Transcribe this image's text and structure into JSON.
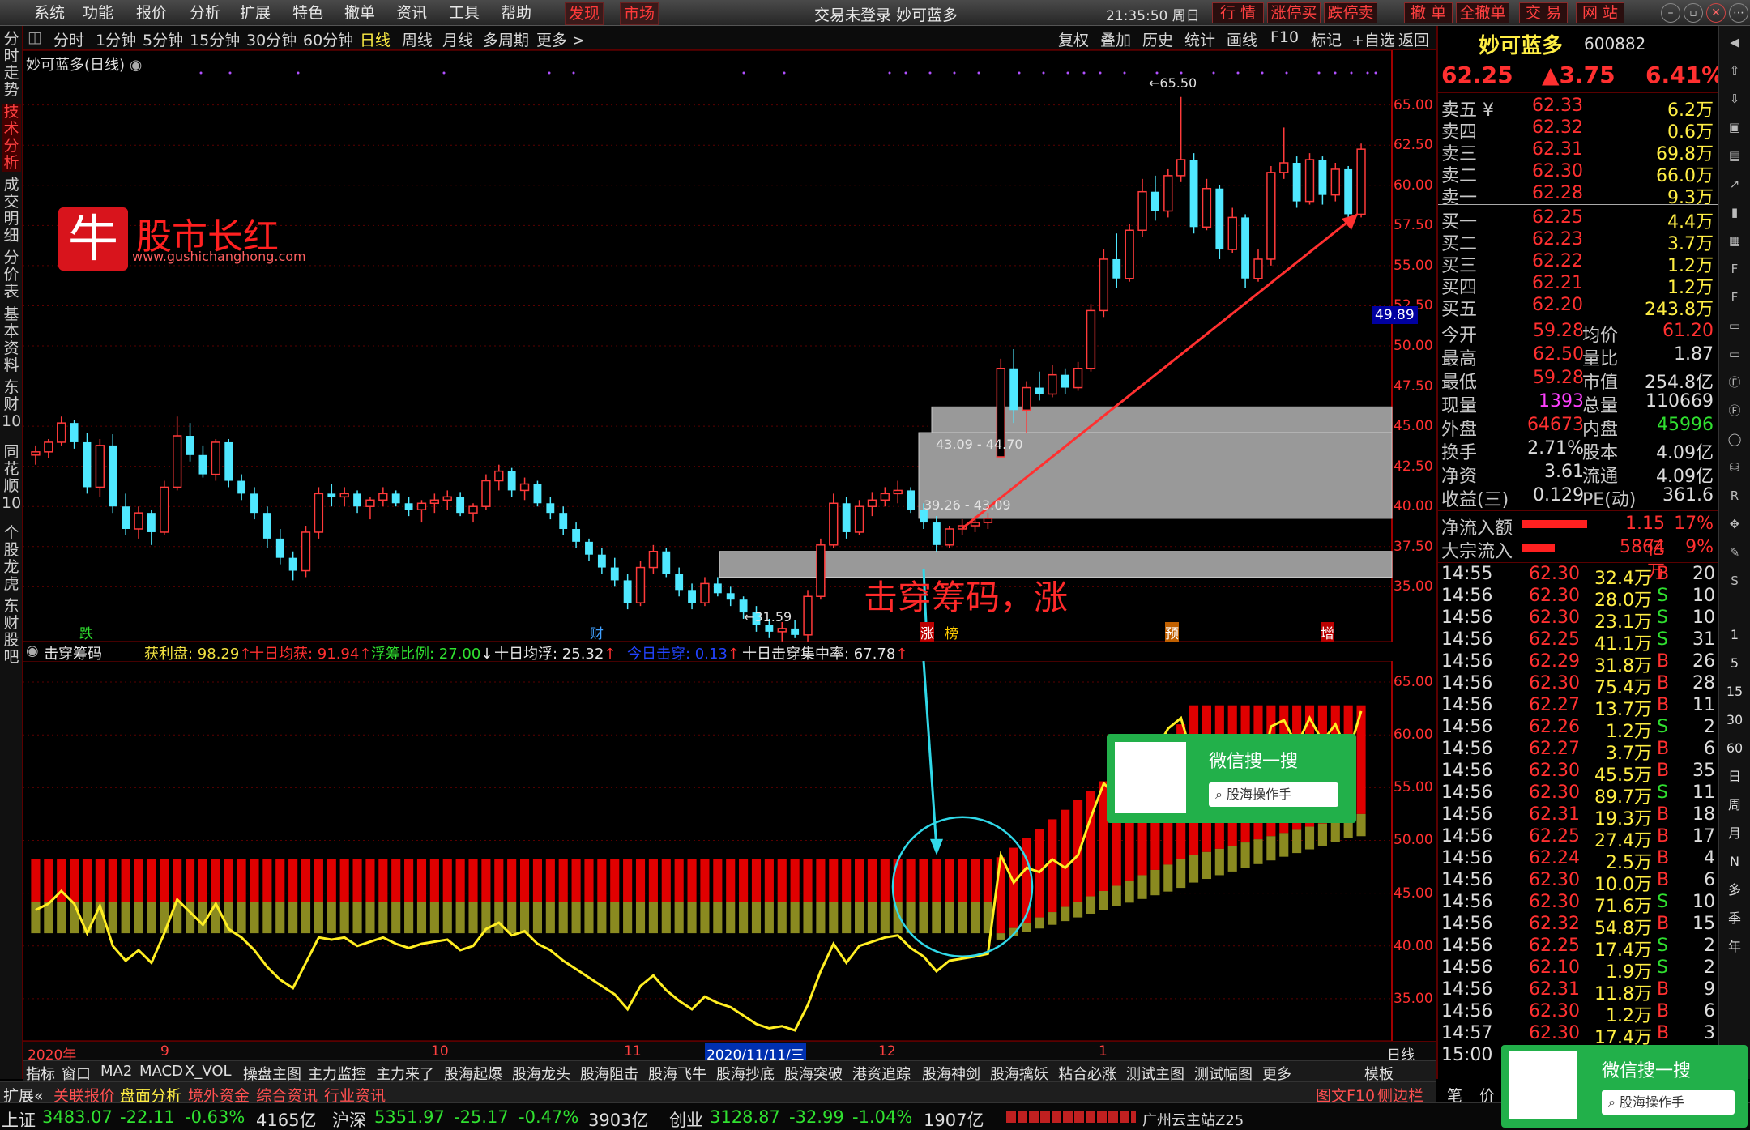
{
  "menu": [
    "系统",
    "功能",
    "报价",
    "分析",
    "扩展",
    "特色",
    "撤单",
    "资讯",
    "工具",
    "帮助",
    "发现",
    "市场"
  ],
  "window_title": "交易未登录  妙可蓝多",
  "clock": "21:35:50 周日",
  "trade_buttons": [
    "行 情",
    "涨停买",
    "跌停卖",
    "撤 单",
    "全撤单",
    "交 易",
    "网 站"
  ],
  "left_nav": [
    "分时走势",
    "技术分析",
    "成交明细",
    "分价表",
    "基本资料",
    "东财10",
    "同花顺10",
    "个股龙虎",
    "东财股吧"
  ],
  "periods": [
    "分时",
    "1分钟",
    "5分钟",
    "15分钟",
    "30分钟",
    "60分钟",
    "日线",
    "周线",
    "月线",
    "多周期",
    "更多 >"
  ],
  "right_tools": [
    "复权",
    "叠加",
    "历史",
    "统计",
    "画线",
    "F10",
    "标记",
    "+自选",
    "返回"
  ],
  "chart_title": "妙可蓝多(日线)",
  "price_axis": [
    "65.00",
    "62.50",
    "60.00",
    "57.50",
    "55.00",
    "52.50",
    "50.00",
    "47.50",
    "45.00",
    "42.50",
    "40.00",
    "37.50",
    "35.00"
  ],
  "current_price_tag": "49.89",
  "annotations": {
    "high": "65.50",
    "low": "31.59",
    "zone1": "43.09 - 44.70",
    "zone2": "39.26 - 43.09"
  },
  "event_markers": [
    "跌",
    "财",
    "涨",
    "榜",
    "预",
    "增"
  ],
  "watermark": {
    "glyph": "牛",
    "name": "股市长红",
    "url": "www.gushichanghong.com"
  },
  "red_caption": "击穿筹码，涨",
  "indicator": {
    "name": "击穿筹码",
    "items": [
      {
        "label": "获利盘: 98.29",
        "arrow": "↑",
        "color": "#f0e040"
      },
      {
        "label": "十日均获: 91.94",
        "arrow": "↑",
        "color": "#ff3030"
      },
      {
        "label": "浮筹比例: 27.00",
        "arrow": "↓",
        "color": "#30e030"
      },
      {
        "label": "十日均浮: 25.32",
        "arrow": "↑",
        "color": "#e6e6e6"
      },
      {
        "label": "今日击穿: 0.13",
        "arrow": "↑",
        "color": "#2244ff"
      },
      {
        "label": "十日击穿集中率: 67.78",
        "arrow": "↑",
        "color": "#e6e6e6"
      }
    ],
    "axis": [
      "65.00",
      "60.00",
      "55.00",
      "50.00",
      "45.00",
      "40.00",
      "35.00"
    ]
  },
  "wechat": {
    "text": "微信搜一搜",
    "search": "股海操作手"
  },
  "date_axis": [
    "2020年",
    "9",
    "10",
    "11",
    "2020/11/11/三",
    "12",
    "1",
    "日线"
  ],
  "bottom_tabs": [
    "指标",
    "窗口",
    "MA2",
    "MACD",
    "X_VOL",
    "操盘主图",
    "主力监控",
    "主力来了",
    "股海起爆",
    "股海龙头",
    "股海阻击",
    "股海飞牛",
    "股海抄底",
    "股海突破",
    "港资追踪",
    "股海神剑",
    "股海擒妖",
    "粘合必涨",
    "测试主图",
    "测试幅图",
    "更多",
    "模板"
  ],
  "bottom_bar": [
    "扩展«",
    "关联报价",
    "盘面分析",
    "境外资金",
    "综合资讯",
    "行业资讯"
  ],
  "bottom_right": [
    "图文F10",
    "侧边栏 «",
    "笔",
    "价"
  ],
  "indices": [
    {
      "name": "上证",
      "val": "3483.07",
      "chg": "-22.11",
      "pct": "-0.63%",
      "amt": "4165亿"
    },
    {
      "name": "沪深",
      "val": "5351.97",
      "chg": "-25.17",
      "pct": "-0.47%",
      "amt": "3903亿"
    },
    {
      "name": "创业",
      "val": "3128.87",
      "chg": "-32.99",
      "pct": "-1.04%",
      "amt": "1907亿"
    }
  ],
  "server": "广州云主站Z25",
  "quote": {
    "name": "妙可蓝多",
    "code": "600882",
    "price": "62.25",
    "change": "▲3.75",
    "pct": "6.41%",
    "sells": [
      [
        "卖五 ¥",
        "62.33",
        "6.2万"
      ],
      [
        "卖四",
        "62.32",
        "0.6万"
      ],
      [
        "卖三",
        "62.31",
        "69.8万"
      ],
      [
        "卖二",
        "62.30",
        "66.0万"
      ],
      [
        "卖一",
        "62.28",
        "9.3万"
      ]
    ],
    "buys": [
      [
        "买一",
        "62.25",
        "4.4万"
      ],
      [
        "买二",
        "62.23",
        "3.7万"
      ],
      [
        "买三",
        "62.22",
        "1.2万"
      ],
      [
        "买四",
        "62.21",
        "1.2万"
      ],
      [
        "买五",
        "62.20",
        "243.8万"
      ]
    ],
    "stats": [
      [
        "今开",
        "59.28",
        "均价",
        "61.20"
      ],
      [
        "最高",
        "62.50",
        "量比",
        "1.87"
      ],
      [
        "最低",
        "59.28",
        "市值",
        "254.8亿"
      ],
      [
        "现量",
        "1393",
        "总量",
        "110669"
      ],
      [
        "外盘",
        "64673",
        "内盘",
        "45996"
      ],
      [
        "换手",
        "2.71%",
        "股本",
        "4.09亿"
      ],
      [
        "净资",
        "3.61",
        "流通",
        "4.09亿"
      ],
      [
        "收益(三)",
        "0.129",
        "PE(动)",
        "361.6"
      ]
    ],
    "flows": [
      [
        "净流入额",
        "1.15亿",
        "17%"
      ],
      [
        "大宗流入",
        "5864万",
        "9%"
      ]
    ],
    "ticks": [
      [
        "14:55",
        "62.30",
        "32.4万",
        "B",
        "20"
      ],
      [
        "14:56",
        "62.30",
        "28.0万",
        "S",
        "10"
      ],
      [
        "14:56",
        "62.30",
        "23.1万",
        "S",
        "10"
      ],
      [
        "14:56",
        "62.25",
        "41.1万",
        "S",
        "31"
      ],
      [
        "14:56",
        "62.29",
        "31.8万",
        "B",
        "26"
      ],
      [
        "14:56",
        "62.30",
        "75.4万",
        "B",
        "28"
      ],
      [
        "14:56",
        "62.27",
        "13.7万",
        "B",
        "11"
      ],
      [
        "14:56",
        "62.26",
        "1.2万",
        "S",
        "2"
      ],
      [
        "14:56",
        "62.27",
        "3.7万",
        "B",
        "6"
      ],
      [
        "14:56",
        "62.30",
        "45.5万",
        "B",
        "35"
      ],
      [
        "14:56",
        "62.30",
        "89.7万",
        "S",
        "11"
      ],
      [
        "14:56",
        "62.31",
        "19.3万",
        "B",
        "18"
      ],
      [
        "14:56",
        "62.25",
        "27.4万",
        "B",
        "17"
      ],
      [
        "14:56",
        "62.24",
        "2.5万",
        "B",
        "4"
      ],
      [
        "14:56",
        "62.30",
        "10.0万",
        "B",
        "6"
      ],
      [
        "14:56",
        "62.30",
        "71.6万",
        "S",
        "10"
      ],
      [
        "14:56",
        "62.32",
        "54.8万",
        "B",
        "15"
      ],
      [
        "14:56",
        "62.25",
        "17.4万",
        "S",
        "2"
      ],
      [
        "14:56",
        "62.10",
        "1.9万",
        "S",
        "2"
      ],
      [
        "14:56",
        "62.31",
        "11.8万",
        "B",
        "9"
      ],
      [
        "14:56",
        "62.30",
        "1.2万",
        "B",
        "6"
      ],
      [
        "14:57",
        "62.30",
        "17.4万",
        "B",
        "3"
      ],
      [
        "15:00",
        "",
        "",
        "",
        ""
      ]
    ]
  },
  "side_tool_labels": [
    "1",
    "5",
    "15",
    "30",
    "60",
    "日",
    "周",
    "月",
    "N",
    "多",
    "季",
    "年"
  ],
  "chart_data": {
    "type": "candlestick",
    "title": "妙可蓝多(日线)",
    "ylim": [
      33,
      67
    ],
    "x_labels": [
      "2020年",
      "9",
      "10",
      "11",
      "12",
      "1"
    ],
    "candles": [
      [
        43.2,
        43.8,
        42.6,
        43.4
      ],
      [
        43.4,
        44.2,
        43.0,
        44.0
      ],
      [
        44.0,
        45.6,
        43.8,
        45.2
      ],
      [
        45.2,
        45.4,
        43.6,
        44.0
      ],
      [
        44.0,
        44.6,
        40.8,
        41.2
      ],
      [
        41.2,
        44.2,
        40.6,
        43.8
      ],
      [
        43.8,
        44.5,
        39.6,
        40.0
      ],
      [
        40.0,
        40.8,
        38.2,
        38.6
      ],
      [
        38.6,
        40.0,
        38.0,
        39.6
      ],
      [
        39.6,
        39.8,
        37.6,
        38.4
      ],
      [
        38.4,
        41.6,
        38.2,
        41.2
      ],
      [
        41.2,
        45.6,
        41.0,
        44.4
      ],
      [
        44.4,
        45.2,
        42.8,
        43.2
      ],
      [
        43.2,
        43.8,
        41.8,
        42.0
      ],
      [
        42.0,
        44.2,
        41.6,
        44.0
      ],
      [
        44.0,
        44.2,
        41.2,
        41.6
      ],
      [
        41.6,
        42.0,
        40.4,
        40.8
      ],
      [
        40.8,
        41.2,
        39.2,
        39.6
      ],
      [
        39.6,
        40.0,
        37.4,
        38.0
      ],
      [
        38.0,
        38.6,
        36.4,
        36.8
      ],
      [
        36.8,
        37.2,
        35.4,
        36.0
      ],
      [
        36.0,
        38.8,
        35.6,
        38.4
      ],
      [
        38.4,
        41.2,
        38.0,
        40.8
      ],
      [
        40.8,
        41.4,
        40.0,
        40.6
      ],
      [
        40.6,
        41.2,
        40.0,
        40.8
      ],
      [
        40.8,
        41.0,
        39.6,
        40.0
      ],
      [
        40.0,
        40.6,
        39.2,
        40.4
      ],
      [
        40.4,
        41.2,
        40.0,
        40.8
      ],
      [
        40.8,
        41.0,
        40.0,
        40.2
      ],
      [
        40.2,
        40.6,
        39.4,
        39.8
      ],
      [
        39.8,
        40.4,
        39.0,
        40.2
      ],
      [
        40.2,
        40.8,
        39.6,
        40.4
      ],
      [
        40.4,
        41.0,
        39.8,
        40.6
      ],
      [
        40.6,
        40.9,
        39.4,
        39.6
      ],
      [
        39.6,
        40.2,
        39.0,
        40.0
      ],
      [
        40.0,
        42.0,
        39.8,
        41.6
      ],
      [
        41.6,
        42.6,
        41.0,
        42.2
      ],
      [
        42.2,
        42.4,
        40.6,
        41.0
      ],
      [
        41.0,
        41.8,
        40.4,
        41.4
      ],
      [
        41.4,
        41.6,
        40.0,
        40.2
      ],
      [
        40.2,
        40.6,
        39.2,
        39.6
      ],
      [
        39.6,
        40.0,
        38.2,
        38.6
      ],
      [
        38.6,
        39.0,
        37.4,
        37.8
      ],
      [
        37.8,
        38.0,
        36.6,
        37.0
      ],
      [
        37.0,
        37.4,
        35.8,
        36.2
      ],
      [
        36.2,
        36.8,
        35.0,
        35.4
      ],
      [
        35.4,
        35.8,
        33.6,
        34.0
      ],
      [
        34.0,
        36.6,
        33.8,
        36.2
      ],
      [
        36.2,
        37.6,
        35.8,
        37.2
      ],
      [
        37.2,
        37.4,
        35.6,
        35.8
      ],
      [
        35.8,
        36.2,
        34.4,
        34.8
      ],
      [
        34.8,
        35.2,
        33.6,
        34.0
      ],
      [
        34.0,
        35.6,
        33.8,
        35.2
      ],
      [
        35.2,
        35.6,
        34.4,
        34.6
      ],
      [
        34.6,
        35.0,
        33.8,
        34.2
      ],
      [
        34.2,
        34.4,
        33.0,
        33.4
      ],
      [
        33.4,
        33.8,
        32.2,
        32.6
      ],
      [
        32.6,
        33.0,
        31.8,
        32.2
      ],
      [
        32.2,
        32.8,
        31.6,
        32.4
      ],
      [
        32.4,
        32.9,
        31.8,
        32.0
      ],
      [
        32.0,
        34.8,
        31.59,
        34.4
      ],
      [
        34.4,
        38.0,
        34.2,
        37.6
      ],
      [
        37.6,
        40.8,
        37.4,
        40.2
      ],
      [
        40.2,
        40.6,
        38.0,
        38.4
      ],
      [
        38.4,
        40.4,
        38.2,
        40.0
      ],
      [
        40.0,
        40.9,
        39.4,
        40.4
      ],
      [
        40.4,
        41.2,
        40.0,
        40.8
      ],
      [
        40.8,
        41.6,
        40.2,
        41.0
      ],
      [
        41.0,
        41.2,
        39.6,
        39.8
      ],
      [
        39.8,
        40.2,
        38.6,
        39.0
      ],
      [
        39.0,
        39.4,
        37.2,
        37.6
      ],
      [
        37.6,
        38.8,
        37.4,
        38.6
      ],
      [
        38.6,
        39.2,
        38.2,
        38.8
      ],
      [
        38.8,
        39.4,
        38.4,
        39.0
      ],
      [
        39.0,
        39.6,
        38.6,
        39.26
      ],
      [
        43.09,
        49.2,
        43.09,
        48.6
      ],
      [
        48.6,
        49.8,
        45.2,
        46.0
      ],
      [
        46.0,
        47.8,
        44.6,
        47.4
      ],
      [
        47.4,
        48.4,
        46.6,
        47.0
      ],
      [
        47.0,
        48.8,
        46.8,
        48.2
      ],
      [
        48.2,
        48.6,
        47.0,
        47.4
      ],
      [
        47.4,
        49.0,
        47.2,
        48.6
      ],
      [
        48.6,
        52.6,
        48.4,
        52.2
      ],
      [
        52.2,
        56.0,
        51.8,
        55.4
      ],
      [
        55.4,
        57.0,
        53.6,
        54.2
      ],
      [
        54.2,
        57.6,
        54.0,
        57.2
      ],
      [
        57.2,
        60.4,
        56.8,
        59.6
      ],
      [
        59.6,
        60.6,
        57.8,
        58.4
      ],
      [
        58.4,
        61.0,
        58.0,
        60.6
      ],
      [
        60.6,
        65.5,
        60.2,
        61.6
      ],
      [
        61.6,
        62.0,
        57.0,
        57.4
      ],
      [
        57.4,
        60.4,
        57.2,
        59.8
      ],
      [
        59.8,
        60.0,
        55.4,
        56.0
      ],
      [
        56.0,
        58.6,
        55.8,
        58.0
      ],
      [
        58.0,
        58.2,
        53.6,
        54.2
      ],
      [
        54.2,
        56.0,
        54.0,
        55.4
      ],
      [
        55.4,
        61.2,
        55.0,
        60.8
      ],
      [
        60.8,
        63.6,
        60.4,
        61.4
      ],
      [
        61.4,
        61.8,
        58.6,
        59.0
      ],
      [
        59.0,
        62.0,
        58.8,
        61.6
      ],
      [
        61.6,
        61.8,
        58.8,
        59.4
      ],
      [
        59.4,
        61.4,
        59.0,
        61.0
      ],
      [
        61.0,
        61.2,
        57.6,
        58.2
      ],
      [
        58.2,
        62.6,
        58.0,
        62.25
      ]
    ]
  }
}
